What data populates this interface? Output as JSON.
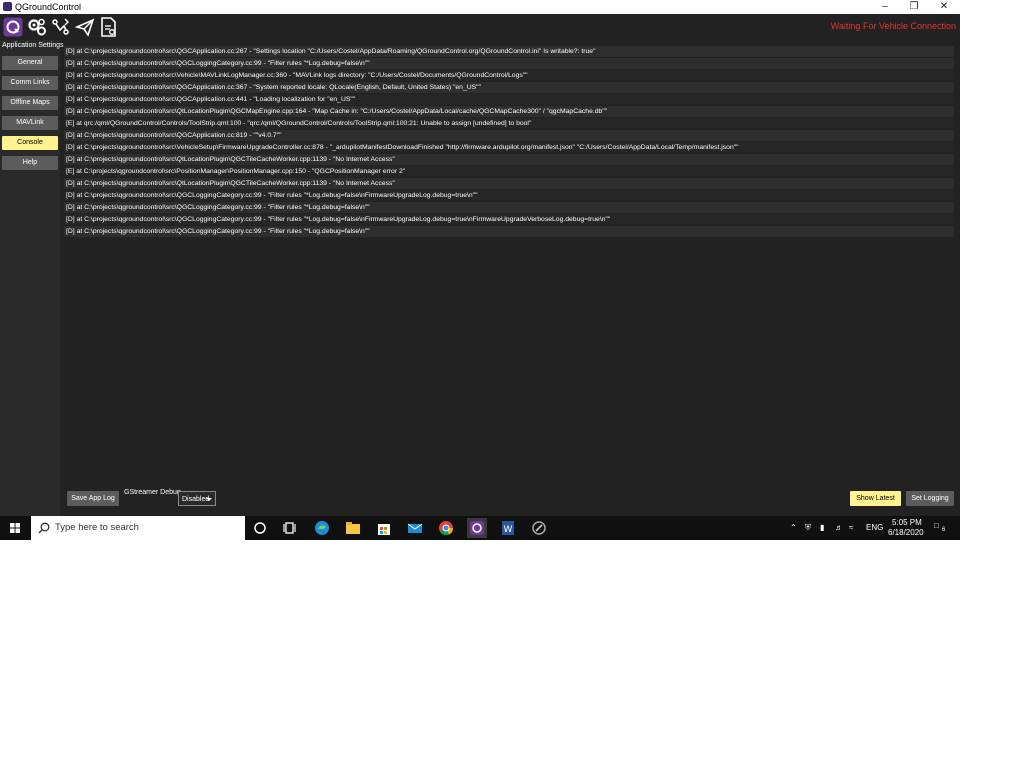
{
  "window": {
    "title": "QGroundControl"
  },
  "toolbar": {
    "status": "Waiting For Vehicle Connection"
  },
  "sidebar": {
    "title": "Application Settings",
    "items": [
      {
        "label": "General",
        "active": false
      },
      {
        "label": "Comm Links",
        "active": false
      },
      {
        "label": "Offline Maps",
        "active": false
      },
      {
        "label": "MAVLink",
        "active": false
      },
      {
        "label": "Console",
        "active": true
      },
      {
        "label": "Help",
        "active": false
      }
    ]
  },
  "log": {
    "lines": [
      "[D] at C:\\projects\\qgroundcontrol\\src\\QGCApplication.cc:267 - \"Settings location \"C:/Users/Costel/AppData/Roaming/QGroundControl.org/QGroundControl.ini\" Is writable?: true\"",
      "[D] at C:\\projects\\qgroundcontrol\\src\\QGCLoggingCategory.cc:99 - \"Filter rules \"*Log.debug=false\\n\"\"",
      "[D] at C:\\projects\\qgroundcontrol\\src\\Vehicle\\MAVLinkLogManager.cc:360 - \"MAVLink logs directory: \"C:/Users/Costel/Documents/QGroundControl/Logs\"\"",
      "[D] at C:\\projects\\qgroundcontrol\\src\\QGCApplication.cc:367 - \"System reported locale: QLocale(English, Default, United States) \"en_US\"\"",
      "[D] at C:\\projects\\qgroundcontrol\\src\\QGCApplication.cc:441 - \"Loading localization for \"en_US\"\"",
      "[D] at C:\\projects\\qgroundcontrol\\src\\QtLocationPlugin\\QGCMapEngine.cpp:164 - \"Map Cache in: \"C:/Users/Costel/AppData/Local/cache/QGCMapCache300\" / \"qgcMapCache.db\"\"",
      "[E] at qrc:/qml/QGroundControl/Controls/ToolStrip.qml:100 - \"qrc:/qml/QGroundControl/Controls/ToolStrip.qml:100:21: Unable to assign [undefined] to bool\"",
      "[D] at C:\\projects\\qgroundcontrol\\src\\QGCApplication.cc:819 - \"\"v4.0.7\"\"",
      "[D] at C:\\projects\\qgroundcontrol\\src\\VehicleSetup\\FirmwareUpgradeController.cc:878 - \"_ardupilotManifestDownloadFinished \"http://firmware.ardupilot.org/manifest.json\" \"C:/Users/Costel/AppData/Local/Temp/manifest.json\"\"",
      "[D] at C:\\projects\\qgroundcontrol\\src\\QtLocationPlugin\\QGCTileCacheWorker.cpp:1139 - \"No Internet Access\"",
      "[E] at C:\\projects\\qgroundcontrol\\src\\PositionManager\\PositionManager.cpp:150 - \"QGCPositionManager error 2\"",
      "[D] at C:\\projects\\qgroundcontrol\\src\\QtLocationPlugin\\QGCTileCacheWorker.cpp:1139 - \"No Internet Access\"",
      "[D] at C:\\projects\\qgroundcontrol\\src\\QGCLoggingCategory.cc:99 - \"Filter rules \"*Log.debug=false\\nFirmwareUpgradeLog.debug=true\\n\"\"",
      "[D] at C:\\projects\\qgroundcontrol\\src\\QGCLoggingCategory.cc:99 - \"Filter rules \"*Log.debug=false\\n\"\"",
      "[D] at C:\\projects\\qgroundcontrol\\src\\QGCLoggingCategory.cc:99 - \"Filter rules \"*Log.debug=false\\nFirmwareUpgradeLog.debug=true\\nFirmwareUpgradeVerboseLog.debug=true\\n\"\"",
      "[D] at C:\\projects\\qgroundcontrol\\src\\QGCLoggingCategory.cc:99 - \"Filter rules \"*Log.debug=false\\n\"\""
    ]
  },
  "bottom": {
    "save_label": "Save App Log",
    "gstreamer_label": "GStreamer Debug",
    "gstreamer_value": "Disabled",
    "show_latest_label": "Show Latest",
    "set_logging_label": "Set Logging"
  },
  "taskbar": {
    "search_placeholder": "Type here to search",
    "language": "ENG",
    "time": "5:05 PM",
    "date": "6/18/2020",
    "notification_count": "6"
  },
  "colors": {
    "accent": "#fff291",
    "status_red": "#e0322f",
    "button_gray": "#5c5c5c",
    "background": "#222222"
  }
}
